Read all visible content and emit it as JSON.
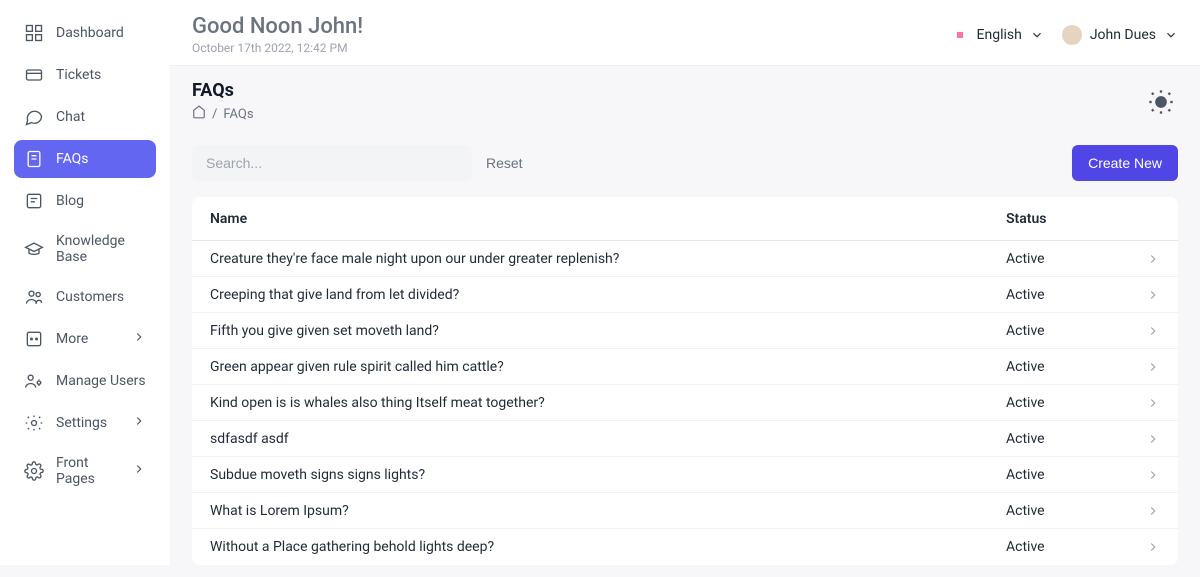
{
  "header": {
    "greeting": "Good Noon John!",
    "datetime": "October 17th 2022, 12:42 PM",
    "language": "English",
    "user_name": "John Dues"
  },
  "page": {
    "title": "FAQs",
    "breadcrumb_current": "FAQs"
  },
  "sidebar": {
    "items": [
      {
        "label": "Dashboard"
      },
      {
        "label": "Tickets"
      },
      {
        "label": "Chat"
      },
      {
        "label": "FAQs"
      },
      {
        "label": "Blog"
      },
      {
        "label": "Knowledge Base"
      },
      {
        "label": "Customers"
      },
      {
        "label": "More"
      },
      {
        "label": "Manage Users"
      },
      {
        "label": "Settings"
      },
      {
        "label": "Front Pages"
      }
    ]
  },
  "controls": {
    "search_placeholder": "Search...",
    "reset_label": "Reset",
    "create_label": "Create New"
  },
  "table": {
    "columns": {
      "name": "Name",
      "status": "Status"
    },
    "rows": [
      {
        "name": "Creature they're face male night upon our under greater replenish?",
        "status": "Active"
      },
      {
        "name": "Creeping that give land from let divided?",
        "status": "Active"
      },
      {
        "name": "Fifth you give given set moveth land?",
        "status": "Active"
      },
      {
        "name": "Green appear given rule spirit called him cattle?",
        "status": "Active"
      },
      {
        "name": "Kind open is is whales also thing Itself meat together?",
        "status": "Active"
      },
      {
        "name": "sdfasdf asdf",
        "status": "Active"
      },
      {
        "name": "Subdue moveth signs signs lights?",
        "status": "Active"
      },
      {
        "name": "What is Lorem Ipsum?",
        "status": "Active"
      },
      {
        "name": "Without a Place gathering behold lights deep?",
        "status": "Active"
      }
    ]
  }
}
